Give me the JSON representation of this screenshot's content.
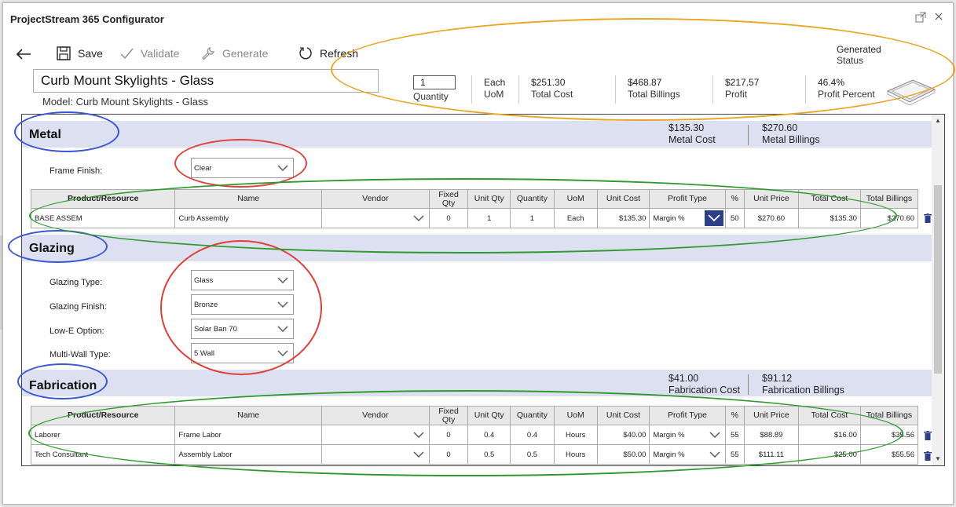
{
  "app": {
    "title": "ProjectStream 365 Configurator"
  },
  "window_controls": {
    "popout": "popout-icon",
    "close": "close-icon"
  },
  "toolbar": {
    "back": "back-arrow-icon",
    "save": "Save",
    "validate": "Validate",
    "generate": "Generate",
    "refresh": "Refresh"
  },
  "status": {
    "value": "Generated",
    "label": "Status"
  },
  "header": {
    "product_name": "Curb Mount Skylights - Glass",
    "model": "Model: Curb Mount Skylights - Glass",
    "quantity": {
      "value": "1",
      "label": "Quantity"
    },
    "uom": {
      "value": "Each",
      "label": "UoM"
    },
    "total_cost": {
      "value": "$251.30",
      "label": "Total Cost"
    },
    "total_billings": {
      "value": "$468.87",
      "label": "Total Billings"
    },
    "profit": {
      "value": "$217.57",
      "label": "Profit"
    },
    "profit_percent": {
      "value": "46.4%",
      "label": "Profit Percent"
    }
  },
  "columns": [
    "Product/Resource",
    "Name",
    "Vendor",
    "Fixed Qty",
    "Unit Qty",
    "Quantity",
    "UoM",
    "Unit Cost",
    "Profit Type",
    "%",
    "Unit Price",
    "Total Cost",
    "Total Billings"
  ],
  "metal": {
    "title": "Metal",
    "cost": {
      "value": "$135.30",
      "label": "Metal Cost"
    },
    "billings": {
      "value": "$270.60",
      "label": "Metal Billings"
    },
    "fields": [
      {
        "label": "Frame Finish:",
        "value": "Clear"
      }
    ],
    "rows": [
      {
        "product": "BASE ASSEM",
        "name": "Curb Assembly",
        "vendor": "",
        "fixed_qty": "0",
        "unit_qty": "1",
        "quantity": "1",
        "uom": "Each",
        "unit_cost": "$135.30",
        "profit_type": "Margin %",
        "pct": "50",
        "unit_price": "$270.60",
        "total_cost": "$135.30",
        "total_billings": "$270.60"
      }
    ]
  },
  "glazing": {
    "title": "Glazing",
    "fields": [
      {
        "label": "Glazing Type:",
        "value": "Glass"
      },
      {
        "label": "Glazing Finish:",
        "value": "Bronze"
      },
      {
        "label": "Low-E Option:",
        "value": "Solar Ban 70"
      },
      {
        "label": "Multi-Wall Type:",
        "value": "5 Wall"
      }
    ]
  },
  "fabrication": {
    "title": "Fabrication",
    "cost": {
      "value": "$41.00",
      "label": "Fabrication Cost"
    },
    "billings": {
      "value": "$91.12",
      "label": "Fabrication Billings"
    },
    "rows": [
      {
        "product": "Laborer",
        "name": "Frame Labor",
        "vendor": "",
        "fixed_qty": "0",
        "unit_qty": "0.4",
        "quantity": "0.4",
        "uom": "Hours",
        "unit_cost": "$40.00",
        "profit_type": "Margin %",
        "pct": "55",
        "unit_price": "$88.89",
        "total_cost": "$16.00",
        "total_billings": "$35.56"
      },
      {
        "product": "Tech Consultant",
        "name": "Assembly Labor",
        "vendor": "",
        "fixed_qty": "0",
        "unit_qty": "0.5",
        "quantity": "0.5",
        "uom": "Hours",
        "unit_cost": "$50.00",
        "profit_type": "Margin %",
        "pct": "55",
        "unit_price": "$111.11",
        "total_cost": "$25.00",
        "total_billings": "$55.56"
      }
    ]
  },
  "annotation_colors": {
    "orange": "#e8a623",
    "blue": "#3a55d6",
    "red": "#e0403a",
    "green": "#2e9a2e",
    "selected_dropdown": "#2b3f8a"
  }
}
